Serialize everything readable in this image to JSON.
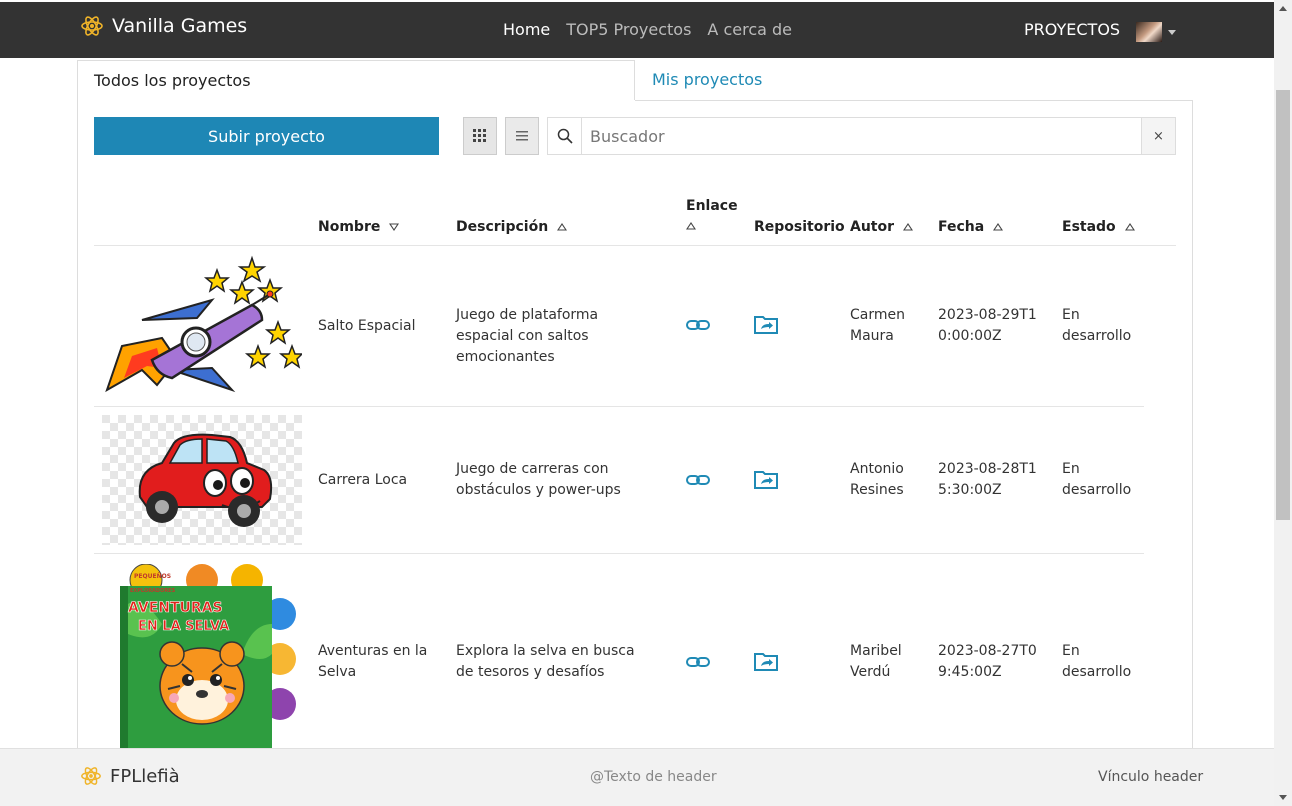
{
  "navbar": {
    "brand": "Vanilla Games",
    "links": [
      {
        "label": "Home",
        "active": true
      },
      {
        "label": "TOP5 Proyectos",
        "active": false
      },
      {
        "label": "A cerca de",
        "active": false
      }
    ],
    "right_label": "PROYECTOS"
  },
  "tabs": [
    {
      "label": "Todos los proyectos",
      "active": true
    },
    {
      "label": "Mis proyectos",
      "active": false
    }
  ],
  "toolbar": {
    "upload_label": "Subir proyecto",
    "search_placeholder": "Buscador",
    "clear_label": "×",
    "active_view": "grid"
  },
  "table": {
    "headers": {
      "name": "Nombre",
      "description": "Descripción",
      "link": "Enlace",
      "repo": "Repositorio",
      "author": "Autor",
      "date": "Fecha",
      "status": "Estado"
    },
    "rows": [
      {
        "image": "rocket",
        "name": "Salto Espacial",
        "description": "Juego de plataforma espacial con saltos emocionantes",
        "author": "Carmen Maura",
        "date": "2023-08-29T10:00:00Z",
        "status": "En desarrollo"
      },
      {
        "image": "red-car",
        "name": "Carrera Loca",
        "description": "Juego de carreras con obstáculos y power-ups",
        "author": "Antonio Resines",
        "date": "2023-08-28T15:30:00Z",
        "status": "En desarrollo"
      },
      {
        "image": "jungle-book",
        "name": "Aventuras en la Selva",
        "description": "Explora la selva en busca de tesoros y desafíos",
        "author": "Maribel Verdú",
        "date": "2023-08-27T09:45:00Z",
        "status": "En desarrollo",
        "image_text": {
          "top": "PEQUEÑOS EXPLORADORES",
          "title": "AVENTURAS EN LA SELVA"
        }
      }
    ]
  },
  "footer": {
    "brand": "FPLlefià",
    "text": "@Texto de header",
    "link": "Vínculo header"
  },
  "colors": {
    "navbar_bg": "#333333",
    "accent": "#1e87b5",
    "brand_icon": "#f0b429"
  }
}
